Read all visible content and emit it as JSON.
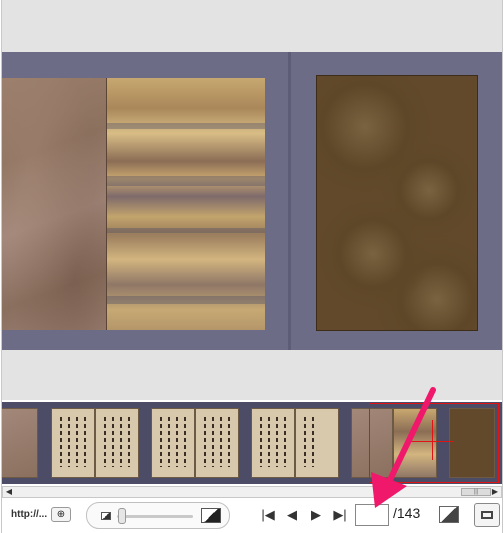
{
  "toolbar": {
    "url_label": "http://...",
    "page_input_value": "",
    "page_total": "/143",
    "nav": {
      "first_icon": "first-page-icon",
      "prev_icon": "prev-page-icon",
      "next_icon": "next-page-icon",
      "last_icon": "last-page-icon"
    }
  },
  "scrollbar": {
    "left_arrow": "◀",
    "right_arrow": "▶",
    "grip": "|||"
  },
  "icons": {
    "first": "|◀",
    "prev": "◀",
    "next": "▶",
    "last": "▶|",
    "fit": "⊕"
  },
  "colors": {
    "viewer_background": "#6d6c86",
    "thumbnail_strip": "#4d4c66",
    "selection_border": "#e01414",
    "annotation_arrow": "#f0186a"
  }
}
